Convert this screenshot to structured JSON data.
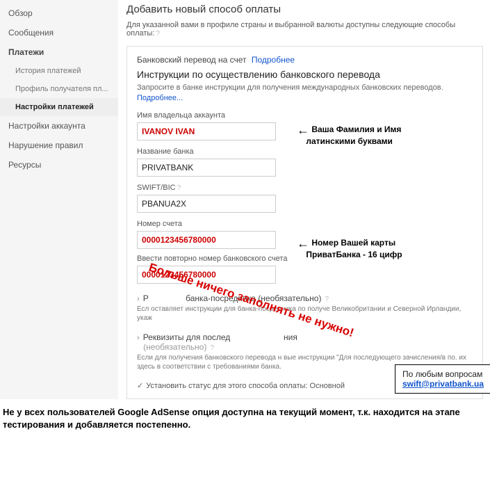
{
  "sidebar": {
    "items": [
      {
        "label": "Обзор",
        "cls": ""
      },
      {
        "label": "Сообщения",
        "cls": ""
      },
      {
        "label": "Платежи",
        "cls": "section"
      },
      {
        "label": "История платежей",
        "cls": "sub"
      },
      {
        "label": "Профиль получателя пл...",
        "cls": "sub"
      },
      {
        "label": "Настройки платежей",
        "cls": "sub active"
      },
      {
        "label": "Настройки аккаунта",
        "cls": ""
      },
      {
        "label": "Нарушение правил",
        "cls": ""
      },
      {
        "label": "Ресурсы",
        "cls": ""
      }
    ]
  },
  "page": {
    "title": "Добавить новый способ оплаты",
    "sub": "Для указанной вами в профиле страны и выбранной валюты доступны следующие способы оплаты:"
  },
  "panel": {
    "header": "Банковский перевод на счет",
    "more": "Подробнее",
    "instr_title": "Инструкции по осуществлению банковского перевода",
    "instr_text": "Запросите в банке инструкции для получения международных банковских переводов.",
    "more2": "Подробнее..."
  },
  "fields": {
    "owner_label": "Имя владельца аккаунта",
    "owner_value": "IVANOV IVAN",
    "bank_label": "Название банка",
    "bank_value": "PRIVATBANK",
    "swift_label": "SWIFT/BIC",
    "swift_value": "PBANUA2X",
    "acct_label": "Номер счета",
    "acct_value": "0000123456780000",
    "acct2_label": "Ввести повторно номер банковского счета",
    "acct2_value": "0000123456780000"
  },
  "annot": {
    "name_line1": "Ваша Фамилия и Имя",
    "name_line2": "латинскими буквами",
    "card_line1": "Номер Вашей карты",
    "card_line2": "ПриватБанка - 16 цифр"
  },
  "diag": "Больше ничего заполнять не нужно!",
  "sec1": {
    "title_a": "Р",
    "title_b": "банка-посредника (необязательно)",
    "desc": "Есл                               оставляет инструкции для банка-посредника по получе                       Великобритании и Северной Ирландии, укаж"
  },
  "sec2": {
    "title_a": "Реквизиты для послед",
    "title_b": "ния",
    "opt": "(необязательно)",
    "desc": "Если для получения банковского перевода н                     вые инструкции \"Для последующего зачисления/в по.                      их здесь в соответствии с требованиями банка."
  },
  "checkbox": "Установить статус для этого способа оплаты: Основной",
  "contact": {
    "line1": "По любым вопросам",
    "email": "swift@privatbank.ua"
  },
  "bottom": "Не у всех пользователей Google AdSense опция доступна на текущий момент, т.к. находится на этапе тестирования и добавляется постепенно.",
  "help_q": "?",
  "chev": "›",
  "check": "✓",
  "arrow": "←"
}
